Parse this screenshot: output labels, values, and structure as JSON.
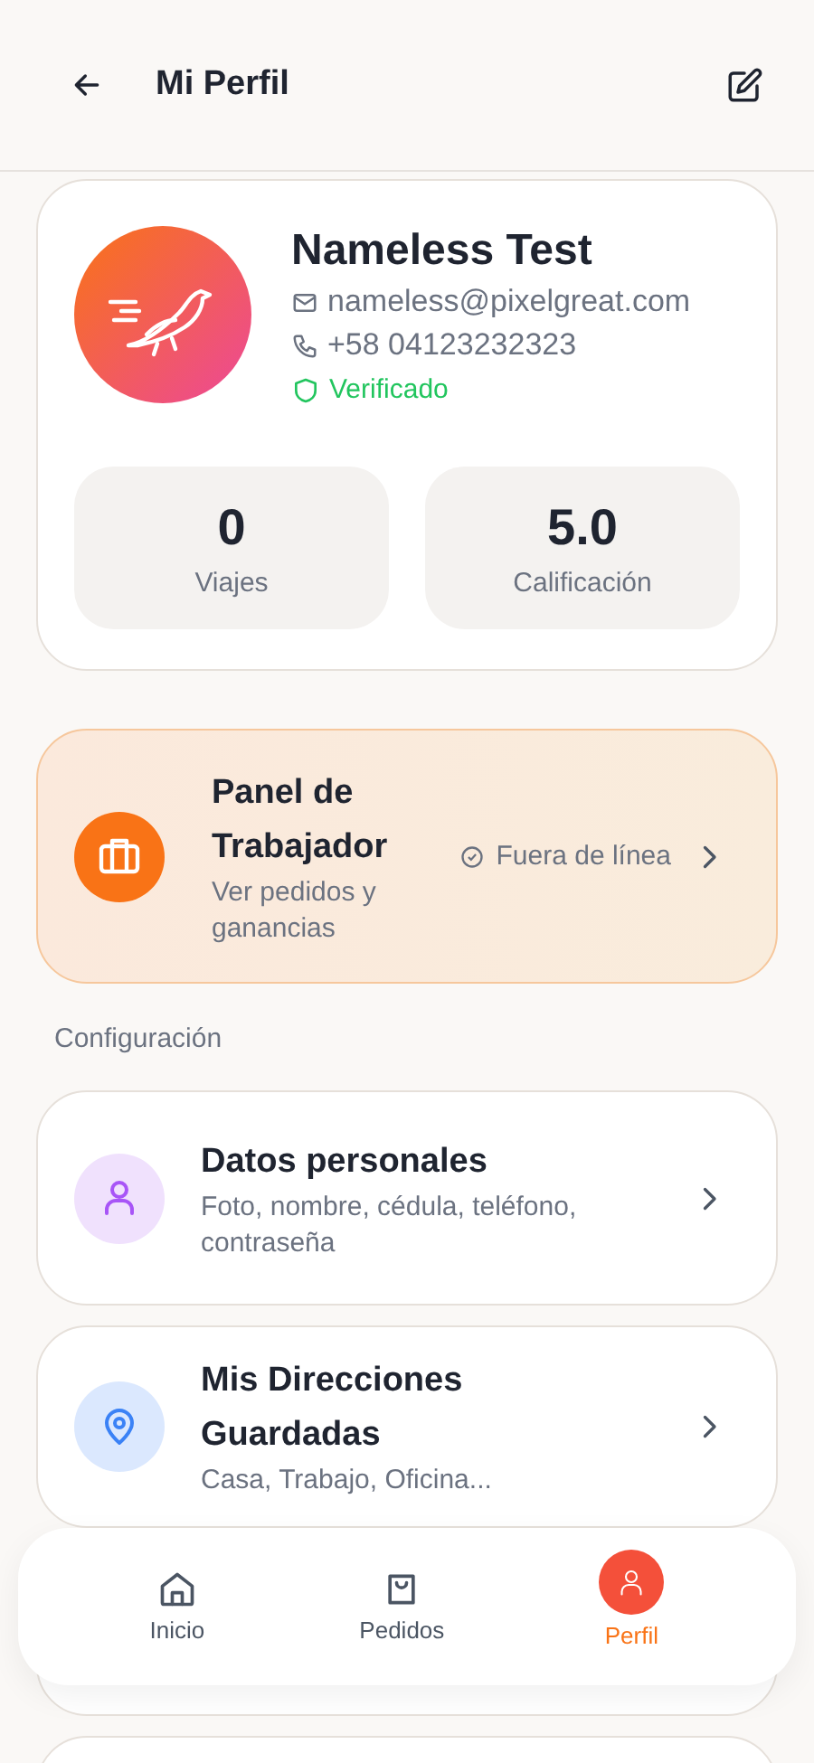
{
  "header": {
    "title": "Mi Perfil"
  },
  "profile": {
    "name": "Nameless Test",
    "email": "nameless@pixelgreat.com",
    "phone": "+58 04123232323",
    "verified": true,
    "verified_label": "Verificado",
    "stats": [
      {
        "value": "0",
        "label": "Viajes"
      },
      {
        "value": "5.0",
        "label": "Calificación"
      }
    ]
  },
  "worker_panel": {
    "title": "Panel de Trabajador",
    "subtitle": "Ver pedidos y ganancias",
    "status": "Fuera de línea"
  },
  "section_label": "Configuración",
  "settings": [
    {
      "title": "Datos personales",
      "subtitle": "Foto, nombre, cédula, teléfono, contraseña",
      "color": "#f0e1fd"
    },
    {
      "title": "Mis Direcciones Guardadas",
      "subtitle": "Casa, Trabajo, Oficina...",
      "color": "#dbe8fe"
    }
  ],
  "bottom_nav": [
    {
      "label": "Inicio",
      "selected": false
    },
    {
      "label": "Pedidos",
      "selected": false
    },
    {
      "label": "Perfil",
      "selected": true
    }
  ]
}
